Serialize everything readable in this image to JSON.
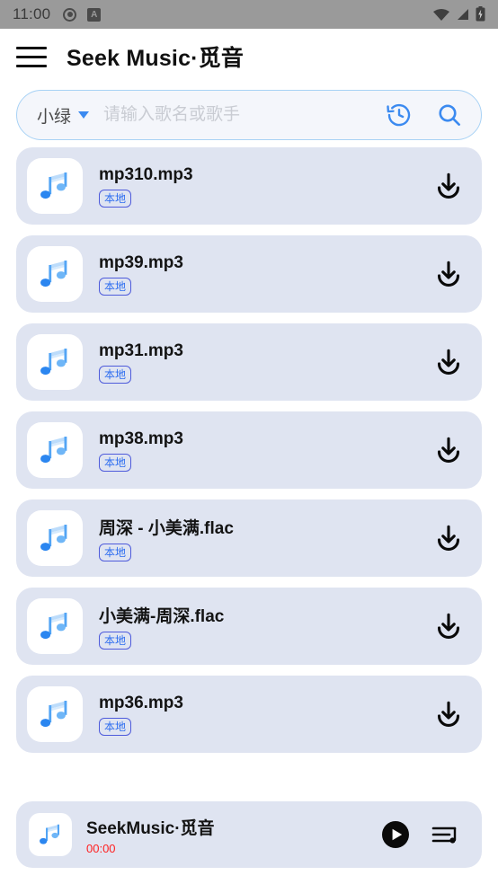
{
  "statusbar": {
    "time": "11:00",
    "left_icons": [
      "record-icon",
      "app-badge-a-icon"
    ],
    "badge_a_label": "A",
    "right_icons": [
      "wifi-icon",
      "cellular-signal-icon",
      "battery-charging-icon"
    ]
  },
  "appbar": {
    "menu_icon": "hamburger-menu-icon",
    "title": "Seek Music·觅音"
  },
  "search": {
    "scope_label": "小绿",
    "scope_caret_icon": "chevron-down-icon",
    "placeholder": "请输入歌名或歌手",
    "value": "",
    "history_icon": "history-clock-icon",
    "search_icon": "search-icon"
  },
  "list": {
    "badge_label": "本地",
    "download_icon": "download-icon",
    "thumb_icon": "music-note-icon",
    "items": [
      {
        "title": "mp310.mp3",
        "badge": "本地"
      },
      {
        "title": "mp39.mp3",
        "badge": "本地"
      },
      {
        "title": "mp31.mp3",
        "badge": "本地"
      },
      {
        "title": "mp38.mp3",
        "badge": "本地"
      },
      {
        "title": "周深 - 小美满.flac",
        "badge": "本地"
      },
      {
        "title": "小美满-周深.flac",
        "badge": "本地"
      },
      {
        "title": "mp36.mp3",
        "badge": "本地"
      }
    ]
  },
  "player": {
    "thumb_icon": "music-note-icon",
    "title": "SeekMusic·觅音",
    "time": "00:00",
    "play_icon": "play-icon",
    "queue_icon": "playlist-queue-icon"
  },
  "colors": {
    "card_bg": "#dfe4f1",
    "accent_blue": "#3b8af0",
    "badge_border": "#4e5bdb",
    "time_red": "#ff2020",
    "statusbar_bg": "#9a9a9a"
  }
}
